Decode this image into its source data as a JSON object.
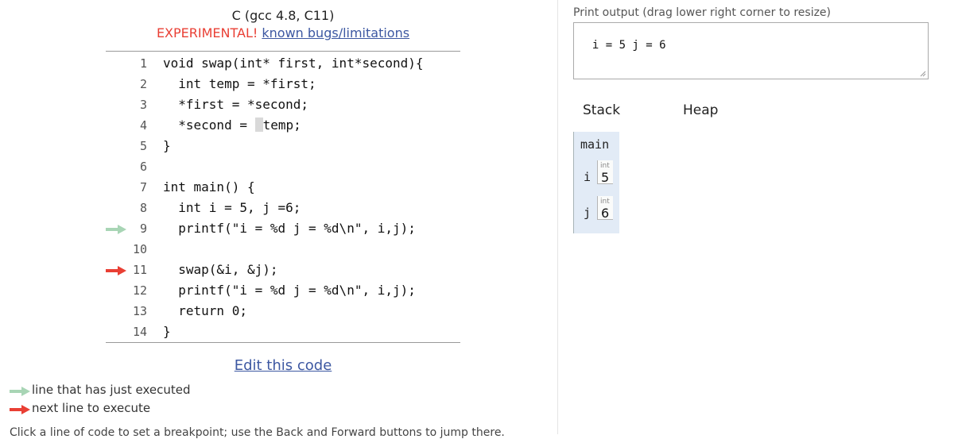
{
  "header": {
    "language": "C (gcc 4.8, C11)",
    "experimental": "EXPERIMENTAL!",
    "bugs_link": "known bugs/limitations"
  },
  "code": {
    "lines": [
      {
        "num": "1",
        "text": "void swap(int* first, int*second){"
      },
      {
        "num": "2",
        "text": "  int temp = *first;"
      },
      {
        "num": "3",
        "text": "  *first = *second;"
      },
      {
        "num": "4",
        "text_before": "  *second = ",
        "text_after": "temp;"
      },
      {
        "num": "5",
        "text": "}"
      },
      {
        "num": "6",
        "text": ""
      },
      {
        "num": "7",
        "text": "int main() {"
      },
      {
        "num": "8",
        "text": "  int i = 5, j =6;"
      },
      {
        "num": "9",
        "text": "  printf(\"i = %d j = %d\\n\", i,j);"
      },
      {
        "num": "10",
        "text": ""
      },
      {
        "num": "11",
        "text": "  swap(&i, &j);"
      },
      {
        "num": "12",
        "text": "  printf(\"i = %d j = %d\\n\", i,j);"
      },
      {
        "num": "13",
        "text": "  return 0;"
      },
      {
        "num": "14",
        "text": "}"
      }
    ],
    "just_executed_line": "9",
    "next_line": "11"
  },
  "edit_link": "Edit this code",
  "legend": {
    "just_executed": "line that has just executed",
    "next_line": "next line to execute"
  },
  "bottom_hint": "Click a line of code to set a breakpoint; use the Back and Forward buttons to jump there.",
  "output": {
    "label": "Print output (drag lower right corner to resize)",
    "text": "i = 5 j = 6"
  },
  "visualizer": {
    "stack_label": "Stack",
    "heap_label": "Heap",
    "frame": {
      "name": "main",
      "vars": [
        {
          "name": "i",
          "type": "int",
          "value": "5"
        },
        {
          "name": "j",
          "type": "int",
          "value": "6"
        }
      ]
    }
  },
  "colors": {
    "just_executed_arrow": "#a8d5b5",
    "next_line_arrow": "#e93f34",
    "link": "#3d58a2",
    "frame_bg": "#e2ebf6"
  }
}
